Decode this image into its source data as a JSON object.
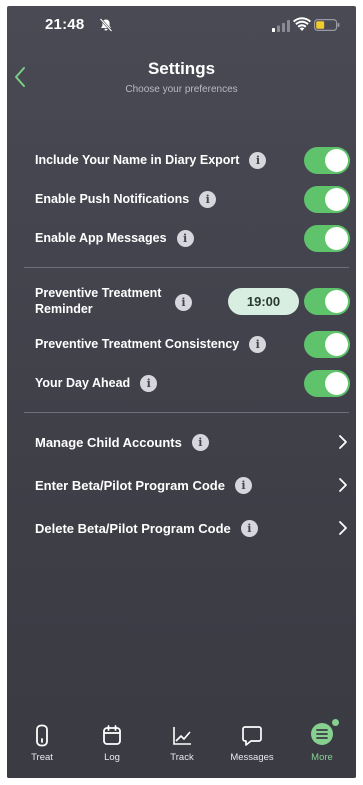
{
  "status_bar": {
    "time": "21:48"
  },
  "header": {
    "title": "Settings",
    "subtitle": "Choose your preferences"
  },
  "section_notifications": [
    {
      "label": "Include Your Name in Diary Export",
      "enabled": true
    },
    {
      "label": "Enable Push Notifications",
      "enabled": true
    },
    {
      "label": "Enable App Messages",
      "enabled": true
    }
  ],
  "section_treatment": {
    "reminder": {
      "label": "Preventive Treatment Reminder",
      "time": "19:00",
      "enabled": true
    },
    "consistency": {
      "label": "Preventive Treatment Consistency",
      "enabled": true
    },
    "day_ahead": {
      "label": "Your Day Ahead",
      "enabled": true
    }
  },
  "section_links": [
    {
      "label": "Manage Child Accounts"
    },
    {
      "label": "Enter Beta/Pilot Program Code"
    },
    {
      "label": "Delete Beta/Pilot Program Code"
    }
  ],
  "info_glyph": "i",
  "tab_bar": [
    {
      "label": "Treat",
      "icon": "phone-device-icon"
    },
    {
      "label": "Log",
      "icon": "calendar-icon"
    },
    {
      "label": "Track",
      "icon": "chart-icon"
    },
    {
      "label": "Messages",
      "icon": "message-bubble-icon"
    },
    {
      "label": "More",
      "icon": "menu-icon",
      "active": true
    }
  ],
  "colors": {
    "background": "#44444d",
    "toggle_on": "#5ec36a",
    "accent": "#86d18f",
    "time_pill": "#d8eee0"
  }
}
